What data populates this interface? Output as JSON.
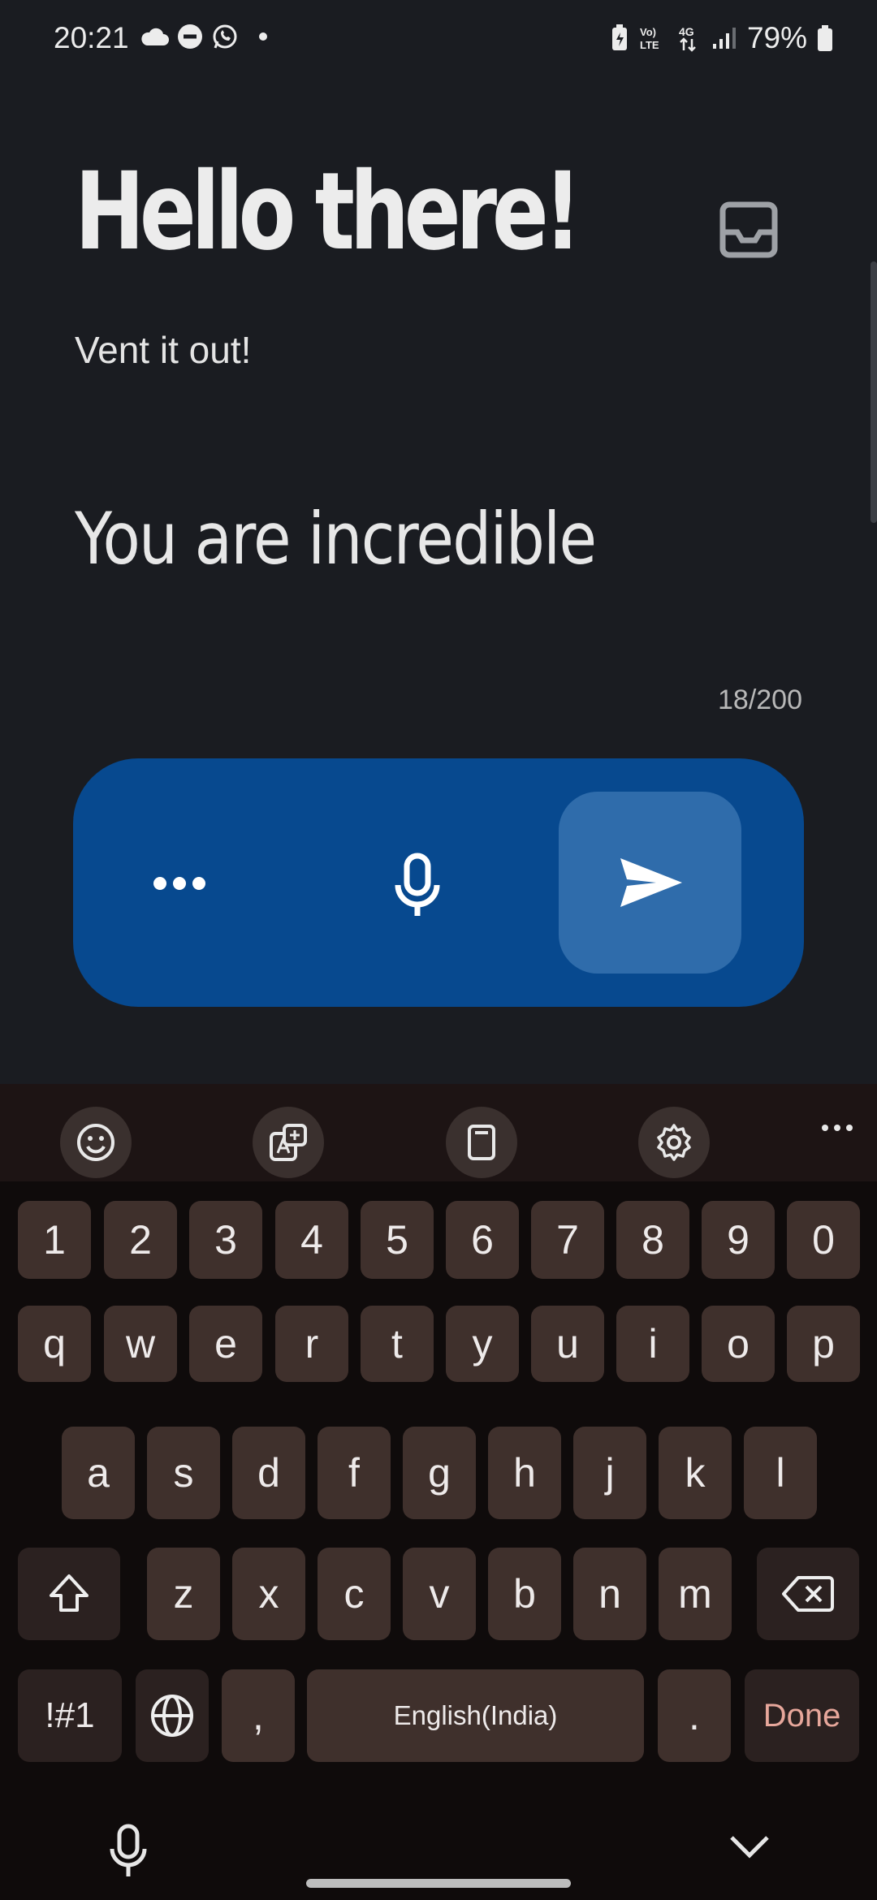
{
  "status_bar": {
    "time": "20:21",
    "battery_percent": "79%",
    "network": "4G",
    "volte": "Vo) LTE"
  },
  "header": {
    "title": "Hello there!",
    "subtitle": "Vent it out!",
    "inbox_icon": "inbox-icon"
  },
  "composer": {
    "text": "You are incredible",
    "counter": "18/200"
  },
  "actions": {
    "more_icon": "more-horizontal-icon",
    "mic_icon": "microphone-icon",
    "send_icon": "send-icon",
    "bar_color": "#07498f",
    "send_color": "#2f6cab"
  },
  "keyboard": {
    "toolbar": [
      "emoji-icon",
      "translate-icon",
      "clipboard-icon",
      "settings-icon",
      "more-icon"
    ],
    "row_numbers": [
      "1",
      "2",
      "3",
      "4",
      "5",
      "6",
      "7",
      "8",
      "9",
      "0"
    ],
    "row1": [
      "q",
      "w",
      "e",
      "r",
      "t",
      "y",
      "u",
      "i",
      "o",
      "p"
    ],
    "row2": [
      "a",
      "s",
      "d",
      "f",
      "g",
      "h",
      "j",
      "k",
      "l"
    ],
    "row3": [
      "z",
      "x",
      "c",
      "v",
      "b",
      "n",
      "m"
    ],
    "symbols_label": "!#1",
    "comma_label": ",",
    "space_label": "English(India)",
    "period_label": ".",
    "done_label": "Done",
    "shift_icon": "shift-icon",
    "backspace_icon": "backspace-icon",
    "globe_icon": "globe-icon"
  },
  "nav": {
    "voice_icon": "microphone-icon",
    "hide_icon": "chevron-down-icon"
  }
}
